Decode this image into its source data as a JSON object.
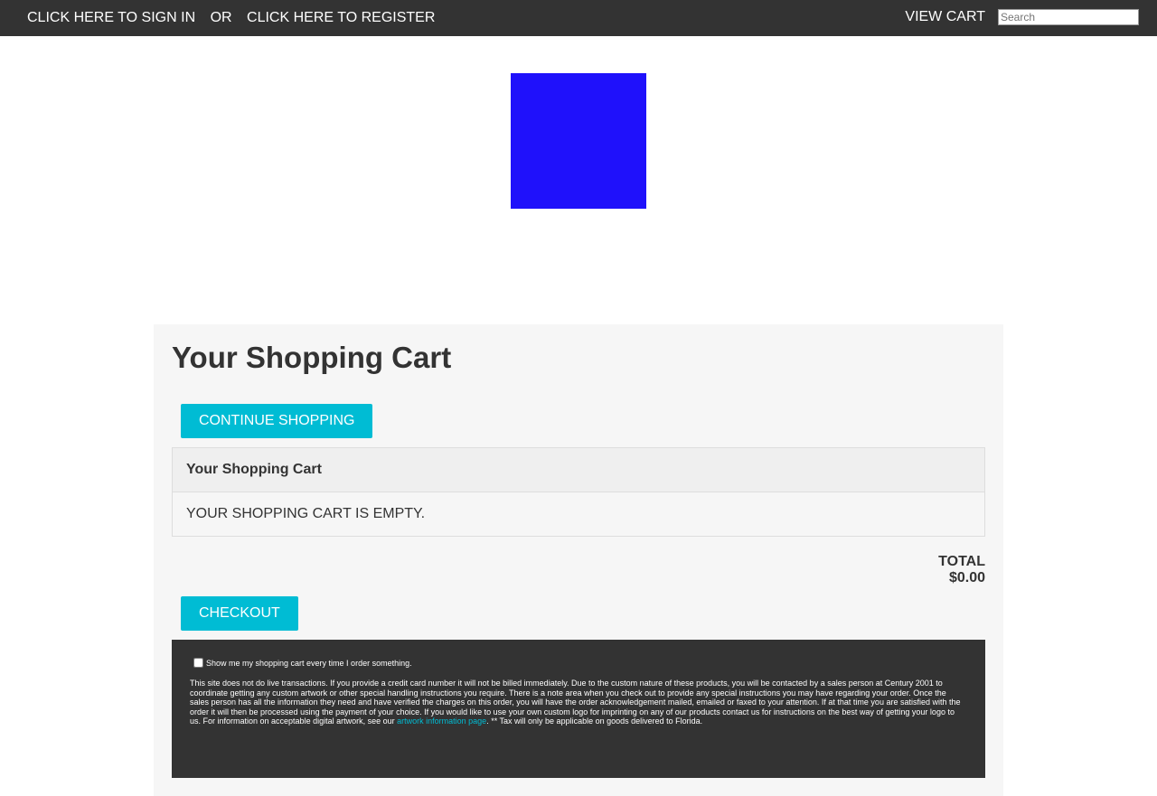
{
  "topbar": {
    "sign_in": "CLICK HERE TO SIGN IN",
    "or": "OR",
    "register": "CLICK HERE TO REGISTER",
    "view_cart": "VIEW CART",
    "search_placeholder": "Search"
  },
  "logo": {
    "color": "#1f11fb"
  },
  "cart": {
    "title": "Your Shopping Cart",
    "continue_label": "CONTINUE SHOPPING",
    "table_header": "Your Shopping Cart",
    "empty_message": "YOUR SHOPPING CART IS EMPTY.",
    "total_label": "TOTAL",
    "total_value": "$0.00",
    "checkout_label": "CHECKOUT"
  },
  "notice": {
    "checkbox_label": "Show me my shopping cart every time I order something.",
    "text_before_link": "This site does not do live transactions. If you provide a credit card number it will not be billed immediately. Due to the custom nature of these products, you will be contacted by a sales person at Century 2001 to coordinate getting any custom artwork or other special handling instructions you require. There is a note area when you check out to provide any special instructions you may have regarding your order. Once the sales person has all the information they need and have verified the charges on this order, you will have the order acknowledgement mailed, emailed or faxed to your attention. If at that time you are satisfied with the order it will then be processed using the payment of your choice. If you would like to use your own custom logo for imprinting on any of our products contact us for instructions on the best way of getting your logo to us. For information on acceptable digital artwork, see our ",
    "link_text": "artwork information page",
    "text_after_link": ". ** Tax will only be applicable on goods delivered to Florida."
  },
  "colors": {
    "topbar": "#333333",
    "accent": "#00bcd4",
    "panel": "#f6f6f6"
  }
}
